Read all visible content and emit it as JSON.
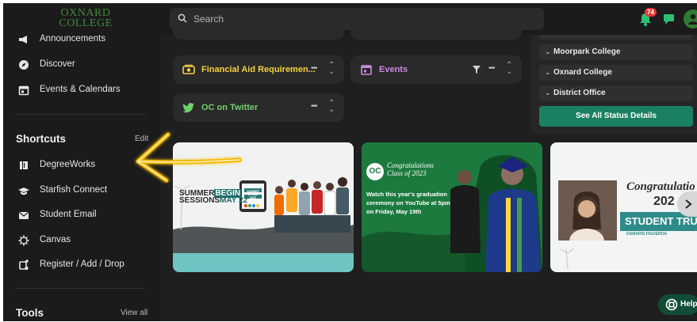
{
  "logo": {
    "line1": "OXNARD",
    "line2": "COLLEGE"
  },
  "search": {
    "placeholder": "Search"
  },
  "notifications": {
    "count": "74"
  },
  "sidebar": {
    "items": [
      {
        "label": "Announcements",
        "icon": "megaphone-icon"
      },
      {
        "label": "Discover",
        "icon": "compass-icon"
      },
      {
        "label": "Events & Calendars",
        "icon": "calendar-icon"
      }
    ],
    "shortcuts": {
      "title": "Shortcuts",
      "edit_label": "Edit",
      "items": [
        {
          "label": "DegreeWorks",
          "icon": "book-icon"
        },
        {
          "label": "Starfish Connect",
          "icon": "graduation-cap-icon"
        },
        {
          "label": "Student Email",
          "icon": "envelope-icon"
        },
        {
          "label": "Canvas",
          "icon": "canvas-icon"
        },
        {
          "label": "Register / Add / Drop",
          "icon": "register-icon"
        }
      ]
    },
    "tools": {
      "title": "Tools",
      "view_all_label": "View all"
    }
  },
  "cards": [
    {
      "label": "Financial Aid Requiremen...",
      "color": "#f4d03f",
      "icon": "money-icon"
    },
    {
      "label": "Events",
      "color": "#c98be0",
      "icon": "calendar-icon"
    },
    {
      "label": "OC on Twitter",
      "color": "#6fd16c",
      "icon": "twitter-icon"
    }
  ],
  "status": {
    "rows": [
      "Moorpark College",
      "Oxnard College",
      "District Office"
    ],
    "button_label": "See All Status Details"
  },
  "slides": [
    {
      "title_line1": "SUMMER",
      "title_word2": "BEGIN",
      "title_line2": "SESSIONS",
      "title_date": "MAY 22",
      "badge_line1": "SUMMER",
      "badge_line2": "& FALL",
      "badge_line3": "2023"
    },
    {
      "title_line1": "Congratulations",
      "title_line2": "Class of 2023",
      "text_line1": "Watch this year's graduation",
      "text_line2": "ceremony on YouTube at 5pm",
      "text_line3": "on Friday, May 19th"
    },
    {
      "title": "Congratulatio",
      "year": "202",
      "banner": "STUDENT TRUS",
      "name": "DAMARIS FIGUEROA"
    }
  ],
  "help": {
    "label": "Help"
  },
  "colors": {
    "accent": "#1b8061",
    "annotation": "#f5b800"
  }
}
